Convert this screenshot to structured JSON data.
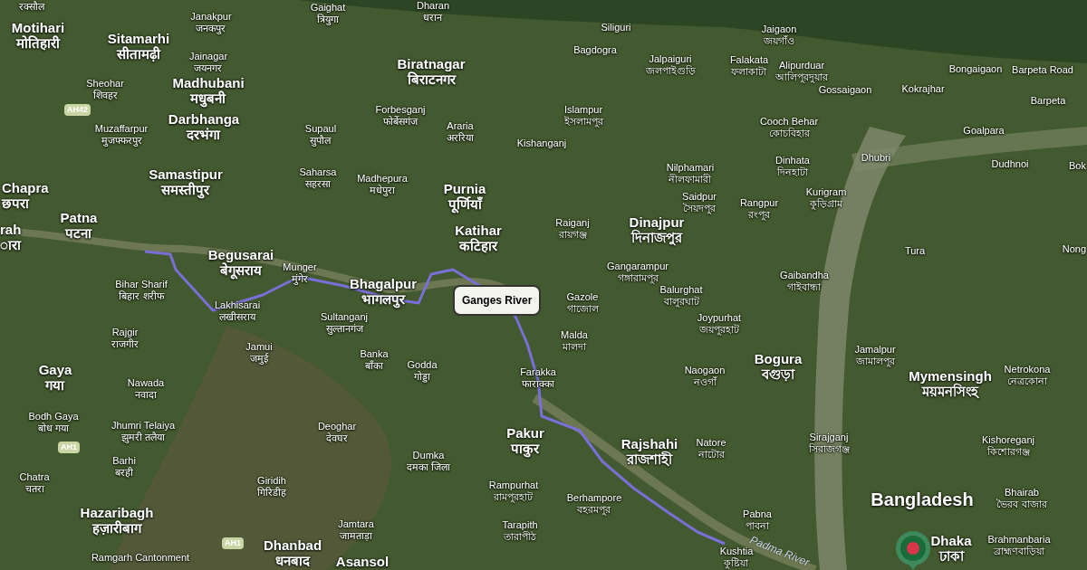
{
  "map": {
    "places": [
      {
        "local": "रक्सौल",
        "kind": "town"
      },
      {
        "name": "Motihari",
        "local": "मोतिहारी",
        "kind": "major"
      },
      {
        "name": "Sitamarhi",
        "local": "सीतामढ़ी",
        "kind": "major"
      },
      {
        "name": "Janakpur",
        "local": "जनकपुर",
        "kind": "town"
      },
      {
        "name": "Jainagar",
        "local": "जयनगर",
        "kind": "town"
      },
      {
        "name": "Gaighat",
        "local": "त्रियुगा",
        "kind": "town"
      },
      {
        "name": "Dharan",
        "local": "धरान",
        "kind": "town"
      },
      {
        "name": "Sheohar",
        "local": "शिवहर",
        "kind": "town"
      },
      {
        "name": "Madhubani",
        "local": "मधुबनी",
        "kind": "major"
      },
      {
        "name": "Biratnagar",
        "local": "बिराटनगर",
        "kind": "major"
      },
      {
        "name": "Muzaffarpur",
        "local": "मुजफ्फरपुर",
        "kind": "town"
      },
      {
        "name": "Darbhanga",
        "local": "दरभंगा",
        "kind": "major"
      },
      {
        "name": "Supaul",
        "local": "सुपौल",
        "kind": "town"
      },
      {
        "name": "Forbesganj",
        "local": "फोर्बेसगंज",
        "kind": "town"
      },
      {
        "name": "Araria",
        "local": "अररिया",
        "kind": "town"
      },
      {
        "name": "Chapra",
        "local": "छपरा",
        "kind": "major"
      },
      {
        "name": "Samastipur",
        "local": "समस्तीपुर",
        "kind": "major"
      },
      {
        "name": "Saharsa",
        "local": "सहरसा",
        "kind": "town"
      },
      {
        "name": "Madhepura",
        "local": "मधेपुरा",
        "kind": "town"
      },
      {
        "name": "Patna",
        "local": "पटना",
        "kind": "major"
      },
      {
        "name": "Purnia",
        "local": "पूर्णियाँ",
        "kind": "major"
      },
      {
        "name": "rah",
        "local": "ारा",
        "kind": "major"
      },
      {
        "name": "Begusarai",
        "local": "बेगूसराय",
        "kind": "major"
      },
      {
        "name": "Katihar",
        "local": "कटिहार",
        "kind": "major"
      },
      {
        "name": "Bihar Sharif",
        "local": "बिहार शरीफ",
        "kind": "town"
      },
      {
        "name": "Munger",
        "local": "मुंगेर",
        "kind": "town"
      },
      {
        "name": "Lakhisarai",
        "local": "लखीसराय",
        "kind": "town"
      },
      {
        "name": "Bhagalpur",
        "local": "भागलपुर",
        "kind": "major"
      },
      {
        "name": "Rajgir",
        "local": "राजगीर",
        "kind": "town"
      },
      {
        "name": "Sultanganj",
        "local": "सुल्तानगंज",
        "kind": "town"
      },
      {
        "name": "Gaya",
        "local": "गया",
        "kind": "major"
      },
      {
        "name": "Nawada",
        "local": "नवादा",
        "kind": "town"
      },
      {
        "name": "Jamui",
        "local": "जमुई",
        "kind": "town"
      },
      {
        "name": "Banka",
        "local": "बाँका",
        "kind": "town"
      },
      {
        "name": "Godda",
        "local": "गोड्डा",
        "kind": "town"
      },
      {
        "name": "Bodh Gaya",
        "local": "बोध गया",
        "kind": "town"
      },
      {
        "name": "Jhumri Telaiya",
        "local": "झुमरी तलैया",
        "kind": "town"
      },
      {
        "name": "Deoghar",
        "local": "देवघर",
        "kind": "town"
      },
      {
        "name": "Chatra",
        "local": "चतरा",
        "kind": "town"
      },
      {
        "name": "Barhi",
        "local": "बरही",
        "kind": "town"
      },
      {
        "name": "Giridih",
        "local": "गिरिडीह",
        "kind": "town"
      },
      {
        "name": "Dumka",
        "local": "दमका जिला",
        "kind": "town"
      },
      {
        "name": "Hazaribagh",
        "local": "हज़ारीबाग",
        "kind": "major"
      },
      {
        "name": "Jamtara",
        "local": "जामताड़ा",
        "kind": "town"
      },
      {
        "name": "Ramgarh Cantonment",
        "kind": "town"
      },
      {
        "name": "Dhanbad",
        "local": "धनबाद",
        "kind": "major"
      },
      {
        "name": "Asansol",
        "kind": "major"
      },
      {
        "name": "Farakka",
        "local": "फाराक्का",
        "kind": "town"
      },
      {
        "name": "Pakur",
        "local": "पाकुर",
        "kind": "major"
      },
      {
        "name": "Rampurhat",
        "local": "রামপুরহাট",
        "kind": "town"
      },
      {
        "name": "Tarapith",
        "local": "তারাপীঠ",
        "kind": "town"
      },
      {
        "name": "Berhampore",
        "local": "বহরমপুর",
        "kind": "town"
      },
      {
        "name": "Rajshahi",
        "local": "রাজশাহী",
        "kind": "major"
      },
      {
        "name": "Natore",
        "local": "নাটোর",
        "kind": "town"
      },
      {
        "name": "Pabna",
        "local": "পাবনা",
        "kind": "town"
      },
      {
        "name": "Kushtia",
        "local": "কুষ্টিয়া",
        "kind": "town"
      },
      {
        "name": "Gazole",
        "local": "গাজোল",
        "kind": "town"
      },
      {
        "name": "Malda",
        "local": "মালদা",
        "kind": "town"
      },
      {
        "name": "Balurghat",
        "local": "বালুরঘাট",
        "kind": "town"
      },
      {
        "name": "Joypurhat",
        "local": "জয়পুরহাট",
        "kind": "town"
      },
      {
        "name": "Naogaon",
        "local": "নওগাঁ",
        "kind": "town"
      },
      {
        "name": "Bogura",
        "local": "বগুড়া",
        "kind": "major"
      },
      {
        "name": "Sirajganj",
        "local": "সিরাজগঞ্জ",
        "kind": "town"
      },
      {
        "name": "Jamalpur",
        "local": "জামালপুর",
        "kind": "town"
      },
      {
        "name": "Mymensingh",
        "local": "ময়মনসিংহ",
        "kind": "major"
      },
      {
        "name": "Netrokona",
        "local": "নেত্রকোনা",
        "kind": "town"
      },
      {
        "name": "Kishoreganj",
        "local": "কিশোরগঞ্জ",
        "kind": "town"
      },
      {
        "name": "Bangladesh",
        "kind": "country"
      },
      {
        "name": "Bhairab",
        "local": "ভৈরব বাজার",
        "kind": "town"
      },
      {
        "name": "Dhaka",
        "local": "ঢাকা",
        "kind": "major"
      },
      {
        "name": "Brahmanbaria",
        "local": "ব্রাহ্মণবাড়িয়া",
        "kind": "town"
      },
      {
        "name": "Siliguri",
        "kind": "town"
      },
      {
        "name": "Bagdogra",
        "kind": "town"
      },
      {
        "name": "Jalpaiguri",
        "local": "জলপাইগুড়ি",
        "kind": "town"
      },
      {
        "name": "Jaigaon",
        "local": "জয়গাঁও",
        "kind": "town"
      },
      {
        "name": "Falakata",
        "local": "ফলাকাটা",
        "kind": "town"
      },
      {
        "name": "Alipurduar",
        "local": "আলিপুরদুয়ার",
        "kind": "town"
      },
      {
        "name": "Gossaigaon",
        "kind": "town"
      },
      {
        "name": "Kokrajhar",
        "kind": "town"
      },
      {
        "name": "Bongaigaon",
        "kind": "town"
      },
      {
        "name": "Barpeta Road",
        "kind": "town"
      },
      {
        "name": "Islampur",
        "local": "ইসলামপুর",
        "kind": "town"
      },
      {
        "name": "Kishanganj",
        "kind": "town"
      },
      {
        "name": "Cooch Behar",
        "local": "কোচবিহার",
        "kind": "town"
      },
      {
        "name": "Barpeta",
        "kind": "town"
      },
      {
        "name": "Goalpara",
        "kind": "town"
      },
      {
        "name": "Nilphamari",
        "local": "নীলফামারী",
        "kind": "town"
      },
      {
        "name": "Dinhata",
        "local": "দিনহাটা",
        "kind": "town"
      },
      {
        "name": "Dhubri",
        "kind": "town"
      },
      {
        "name": "Dudhnoi",
        "kind": "town"
      },
      {
        "name": "Bok",
        "kind": "town"
      },
      {
        "name": "Saidpur",
        "local": "সৈয়দপুর",
        "kind": "town"
      },
      {
        "name": "Rangpur",
        "local": "রংপুর",
        "kind": "town"
      },
      {
        "name": "Kurigram",
        "local": "কুড়িগ্রাম",
        "kind": "town"
      },
      {
        "name": "Raiganj",
        "local": "রায়গঞ্জ",
        "kind": "town"
      },
      {
        "name": "Dinajpur",
        "local": "দিনাজপুর",
        "kind": "major"
      },
      {
        "name": "Tura",
        "kind": "town"
      },
      {
        "name": "Nong",
        "kind": "town"
      },
      {
        "name": "Gangarampur",
        "local": "গঙ্গারামপুর",
        "kind": "town"
      },
      {
        "name": "Gaibandha",
        "local": "গাইবান্ধা",
        "kind": "town"
      }
    ],
    "highway_shields": [
      "AH42",
      "AH1",
      "AH1"
    ],
    "water_labels": [
      "Padma River"
    ],
    "selected_river": {
      "label": "Ganges River"
    },
    "country_pin": {
      "visible": true
    }
  }
}
